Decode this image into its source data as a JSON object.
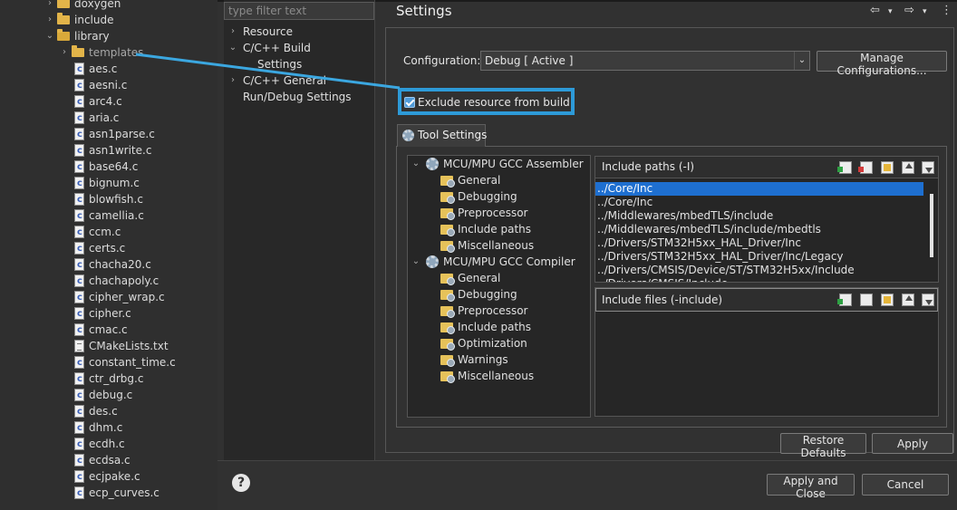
{
  "explorer": {
    "items": [
      {
        "label": "doxygen",
        "kind": "folder",
        "indent": 1,
        "twisty": ">"
      },
      {
        "label": "include",
        "kind": "folder",
        "indent": 1,
        "twisty": ">"
      },
      {
        "label": "library",
        "kind": "folder-open",
        "indent": 1,
        "twisty": "v"
      },
      {
        "label": "templates",
        "kind": "folder",
        "indent": 2,
        "twisty": ">"
      },
      {
        "label": "aes.c",
        "kind": "c"
      },
      {
        "label": "aesni.c",
        "kind": "c"
      },
      {
        "label": "arc4.c",
        "kind": "c"
      },
      {
        "label": "aria.c",
        "kind": "c"
      },
      {
        "label": "asn1parse.c",
        "kind": "c"
      },
      {
        "label": "asn1write.c",
        "kind": "c"
      },
      {
        "label": "base64.c",
        "kind": "c"
      },
      {
        "label": "bignum.c",
        "kind": "c"
      },
      {
        "label": "blowfish.c",
        "kind": "c"
      },
      {
        "label": "camellia.c",
        "kind": "c"
      },
      {
        "label": "ccm.c",
        "kind": "c"
      },
      {
        "label": "certs.c",
        "kind": "c"
      },
      {
        "label": "chacha20.c",
        "kind": "c"
      },
      {
        "label": "chachapoly.c",
        "kind": "c"
      },
      {
        "label": "cipher_wrap.c",
        "kind": "c"
      },
      {
        "label": "cipher.c",
        "kind": "c"
      },
      {
        "label": "cmac.c",
        "kind": "c"
      },
      {
        "label": "CMakeLists.txt",
        "kind": "txt"
      },
      {
        "label": "constant_time.c",
        "kind": "c"
      },
      {
        "label": "ctr_drbg.c",
        "kind": "c"
      },
      {
        "label": "debug.c",
        "kind": "c"
      },
      {
        "label": "des.c",
        "kind": "c"
      },
      {
        "label": "dhm.c",
        "kind": "c"
      },
      {
        "label": "ecdh.c",
        "kind": "c"
      },
      {
        "label": "ecdsa.c",
        "kind": "c"
      },
      {
        "label": "ecjpake.c",
        "kind": "c"
      },
      {
        "label": "ecp_curves.c",
        "kind": "c"
      }
    ]
  },
  "nav": {
    "filter_placeholder": "type filter text",
    "items": [
      {
        "label": "Resource",
        "twisty": ">",
        "indent": 0
      },
      {
        "label": "C/C++ Build",
        "twisty": "v",
        "indent": 0
      },
      {
        "label": "Settings",
        "twisty": "",
        "indent": 1
      },
      {
        "label": "C/C++ General",
        "twisty": ">",
        "indent": 0
      },
      {
        "label": "Run/Debug Settings",
        "twisty": "",
        "indent": 0
      }
    ]
  },
  "page": {
    "title": "Settings",
    "back_glyph": "⇦",
    "fwd_glyph": "⇨",
    "menu_glyph": "⋮"
  },
  "config": {
    "label": "Configuration:",
    "value": "Debug  [ Active ]",
    "arrow": "⌄",
    "manage_label": "Manage Configurations..."
  },
  "exclude": {
    "label": "Exclude resource from build",
    "checked": true
  },
  "tabs": {
    "tool_settings": "Tool Settings"
  },
  "tool_tree": {
    "groups": [
      {
        "label": "MCU/MPU GCC Assembler",
        "children": [
          "General",
          "Debugging",
          "Preprocessor",
          "Include paths",
          "Miscellaneous"
        ]
      },
      {
        "label": "MCU/MPU GCC Compiler",
        "children": [
          "General",
          "Debugging",
          "Preprocessor",
          "Include paths",
          "Optimization",
          "Warnings",
          "Miscellaneous"
        ]
      }
    ]
  },
  "include_paths": {
    "title": "Include paths (-I)",
    "items": [
      "../Core/Inc",
      "../Core/Inc",
      "../Middlewares/mbedTLS/include",
      "../Middlewares/mbedTLS/include/mbedtls",
      "../Drivers/STM32H5xx_HAL_Driver/Inc",
      "../Drivers/STM32H5xx_HAL_Driver/Inc/Legacy",
      "../Drivers/CMSIS/Device/ST/STM32H5xx/Include",
      "../Drivers/CMSIS/Include"
    ],
    "selected_index": 0
  },
  "include_files": {
    "title": "Include files (-include)"
  },
  "buttons": {
    "restore_defaults": "Restore Defaults",
    "apply": "Apply",
    "apply_and_close": "Apply and Close",
    "cancel": "Cancel",
    "help": "?"
  },
  "colors": {
    "highlight_box": "#2d9ad8",
    "annotation_line": "#3ba7e0",
    "selection": "#1e6fd0"
  }
}
